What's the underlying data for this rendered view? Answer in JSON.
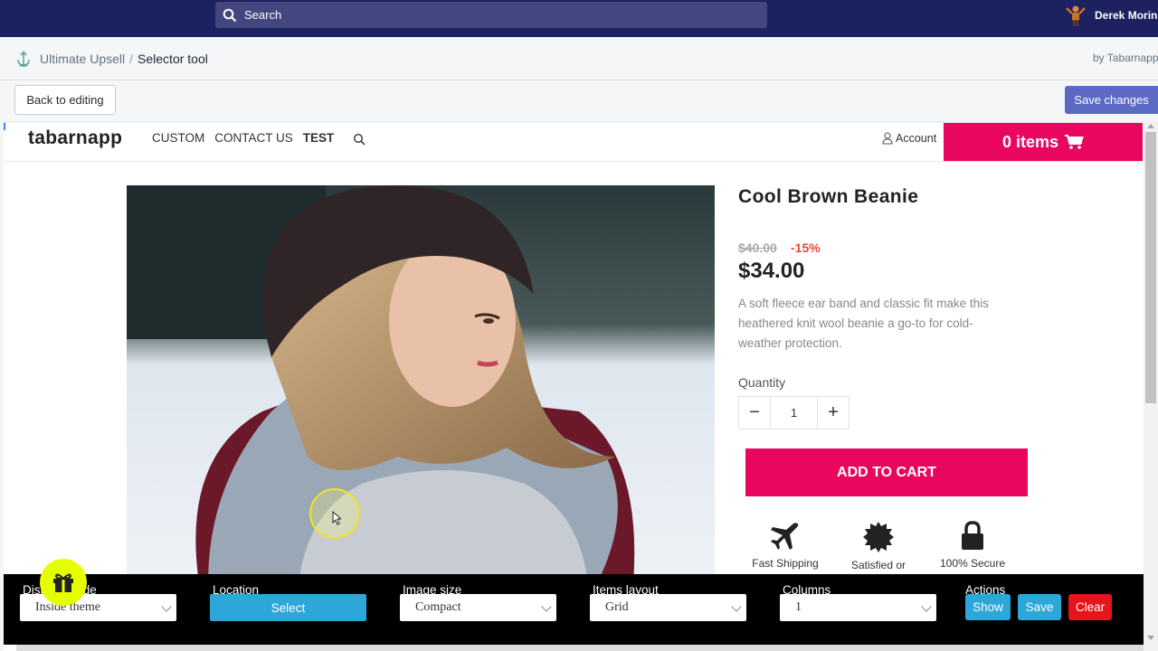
{
  "topbar": {
    "search_placeholder": "Search",
    "user_name": "Derek Morin"
  },
  "titlebar": {
    "app_name": "Ultimate Upsell",
    "separator": "/",
    "current_page": "Selector tool",
    "by_label": "by Tabarnapp"
  },
  "actions": {
    "back_label": "Back to editing",
    "save_label": "Save changes"
  },
  "shop": {
    "logo": "tabarnapp",
    "menu": [
      "CUSTOM",
      "CONTACT US",
      "TEST"
    ],
    "account_label": "Account",
    "cart_label": "0 items",
    "product": {
      "title": "Cool Brown Beanie",
      "old_price": "$40.00",
      "discount": "-15%",
      "price": "$34.00",
      "description": "A soft fleece ear band and classic fit make this heathered knit wool beanie a go-to for cold-weather protection.",
      "quantity_label": "Quantity",
      "quantity": "1",
      "add_to_cart": "ADD TO CART",
      "badges": [
        "Fast Shipping",
        "Satisfied or",
        "100% Secure"
      ]
    }
  },
  "toolbar": {
    "display_label": "Display mode",
    "display_value": "Inside theme",
    "location_label": "Location",
    "location_button": "Select",
    "image_size_label": "Image size",
    "image_size_value": "Compact",
    "items_layout_label": "Items layout",
    "items_layout_value": "Grid",
    "columns_label": "Columns",
    "columns_value": "1",
    "actions_label": "Actions",
    "show_label": "Show",
    "save_label": "Save",
    "clear_label": "Clear"
  },
  "colors": {
    "brand_pink": "#e8065e",
    "topbar": "#1c2260",
    "primary": "#5c6ac4",
    "info": "#2da7d9",
    "danger": "#e5151b"
  }
}
